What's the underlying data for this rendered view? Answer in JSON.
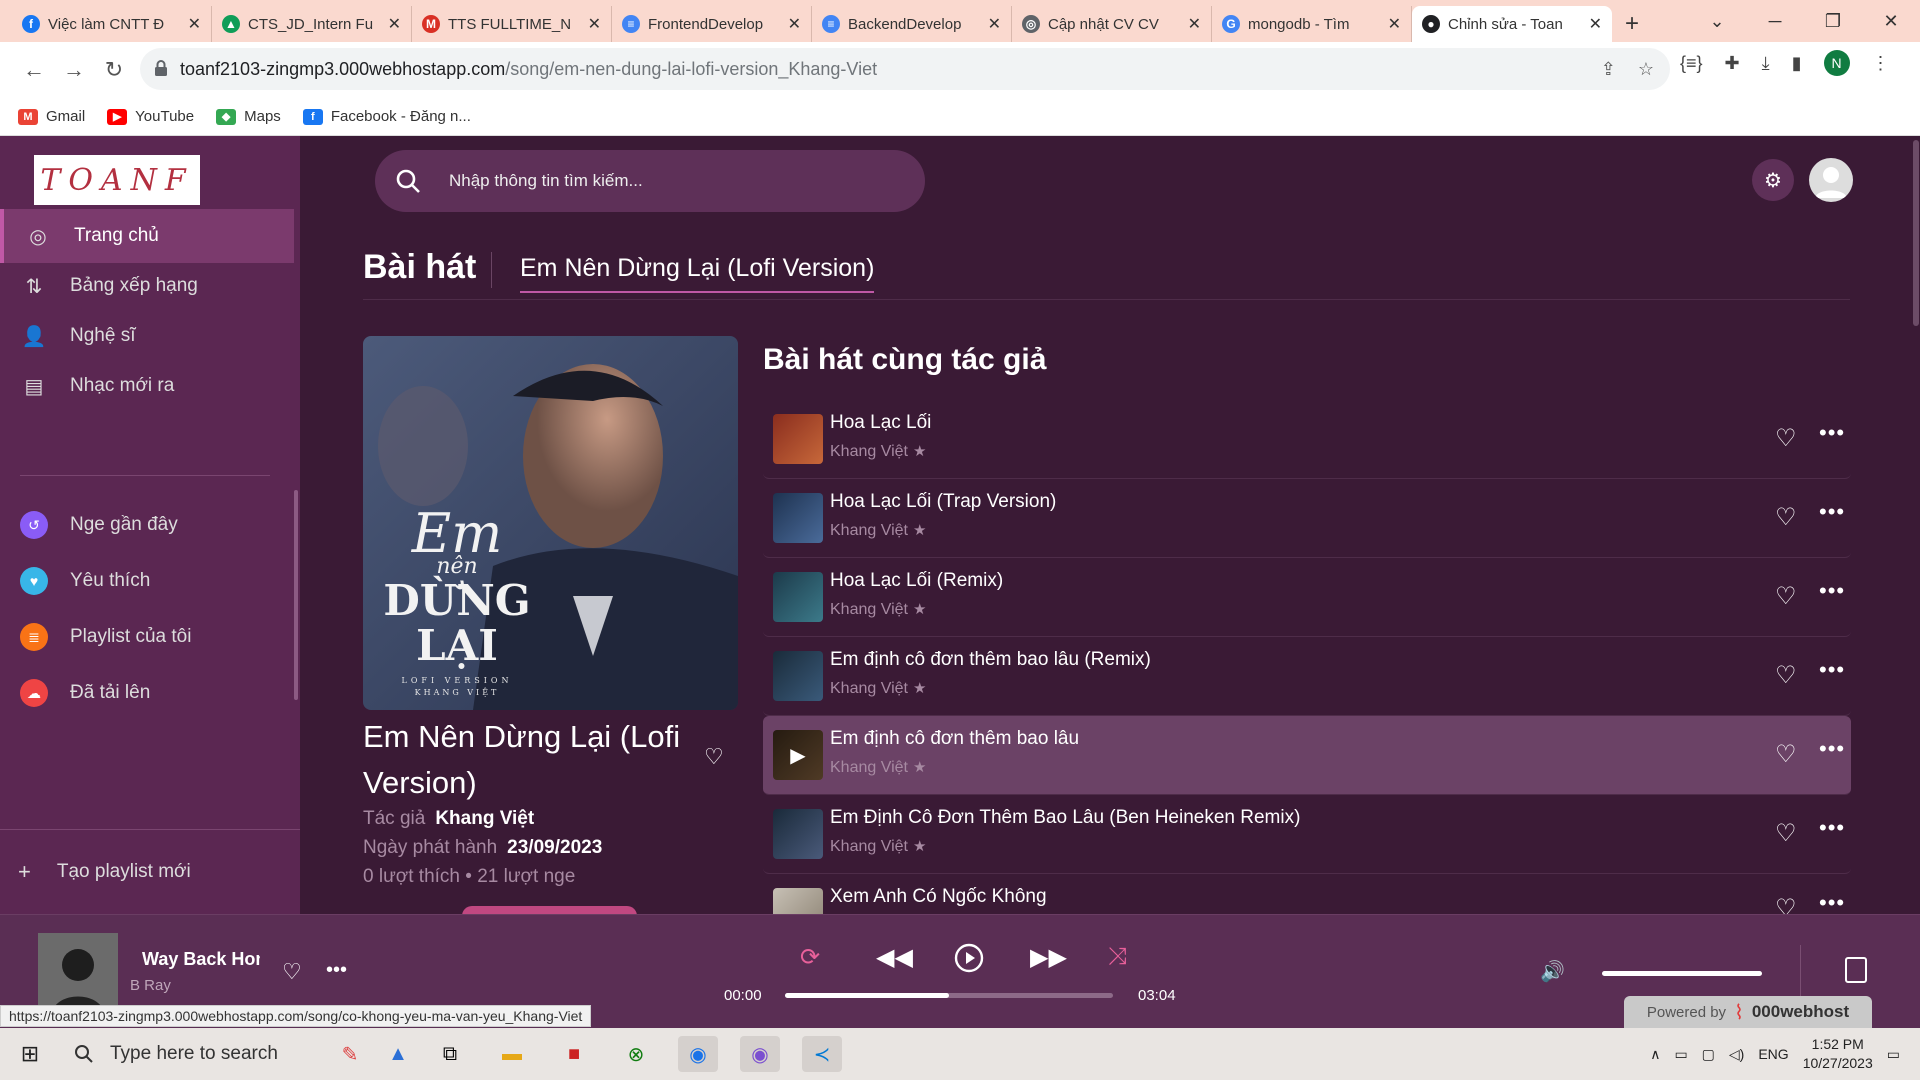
{
  "browser": {
    "tabs": [
      {
        "title": "Việc làm CNTT Đ",
        "color": "#1877f2",
        "glyph": "f"
      },
      {
        "title": "CTS_JD_Intern Fu",
        "color": "#0f9d58",
        "glyph": "▲"
      },
      {
        "title": "TTS FULLTIME_N",
        "color": "#d93025",
        "glyph": "M"
      },
      {
        "title": "FrontendDevelop",
        "color": "#4285f4",
        "glyph": "≡"
      },
      {
        "title": "BackendDevelop",
        "color": "#4285f4",
        "glyph": "≡"
      },
      {
        "title": "Cập nhật CV CV",
        "color": "#5f6368",
        "glyph": "◎"
      },
      {
        "title": "mongodb - Tìm",
        "color": "#4285f4",
        "glyph": "G"
      },
      {
        "title": "Chỉnh sửa - Toan",
        "color": "#202124",
        "glyph": "●"
      }
    ],
    "url_domain": "toanf2103-zingmp3.000webhostapp.com",
    "url_path": "/song/em-nen-dung-lai-lofi-version_Khang-Viet",
    "profile_initial": "N",
    "bookmarks": [
      {
        "label": "Gmail",
        "color": "#ea4335",
        "glyph": "M"
      },
      {
        "label": "YouTube",
        "color": "#ff0000",
        "glyph": "▶"
      },
      {
        "label": "Maps",
        "color": "#34a853",
        "glyph": "◆"
      },
      {
        "label": "Facebook - Đăng n...",
        "color": "#1877f2",
        "glyph": "f"
      }
    ]
  },
  "sidebar": {
    "logo": "TOANF",
    "items": [
      {
        "label": "Trang chủ",
        "icon": "home-disc-icon"
      },
      {
        "label": "Bảng xếp hạng",
        "icon": "ranking-icon"
      },
      {
        "label": "Nghệ sĩ",
        "icon": "artist-icon"
      },
      {
        "label": "Nhạc mới ra",
        "icon": "news-icon"
      }
    ],
    "library": [
      {
        "label": "Nge gần đây",
        "color": "#8a5cf6",
        "glyph": "↺"
      },
      {
        "label": "Yêu thích",
        "color": "#38b6e8",
        "glyph": "♥"
      },
      {
        "label": "Playlist của tôi",
        "color": "#f97316",
        "glyph": "≣"
      },
      {
        "label": "Đã tải lên",
        "color": "#ef4444",
        "glyph": "☁"
      }
    ],
    "new_playlist": "Tạo playlist mới"
  },
  "search": {
    "placeholder": "Nhập thông tin tìm kiếm..."
  },
  "header": {
    "title": "Bài hát",
    "active_tab": "Em Nên Dừng Lại (Lofi Version)"
  },
  "song": {
    "cover_text_1": "Em",
    "cover_text_2": "nên",
    "cover_text_3": "DỪNG",
    "cover_text_4": "LẠI",
    "cover_sub": "LOFI VERSION",
    "cover_artist": "KHANG VIỆT",
    "title": "Em Nên Dừng Lại (Lofi Version)",
    "author_label": "Tác giả",
    "author": "Khang Việt",
    "release_label": "Ngày phát hành",
    "release_date": "23/09/2023",
    "stats": "0 lượt thích • 21 lượt nge"
  },
  "related": {
    "title": "Bài hát cùng tác giả",
    "songs": [
      {
        "name": "Hoa Lạc Lối",
        "artist": "Khang Việt"
      },
      {
        "name": "Hoa Lạc Lối (Trap Version)",
        "artist": "Khang Việt"
      },
      {
        "name": "Hoa Lạc Lối (Remix)",
        "artist": "Khang Việt"
      },
      {
        "name": "Em định cô đơn thêm bao lâu (Remix)",
        "artist": "Khang Việt"
      },
      {
        "name": "Em định cô đơn thêm bao lâu",
        "artist": "Khang Việt"
      },
      {
        "name": "Em Định Cô Đơn Thêm Bao Lâu (Ben Heineken Remix)",
        "artist": "Khang Việt"
      },
      {
        "name": "Xem Anh Có Ngốc Không",
        "artist": ""
      }
    ]
  },
  "player": {
    "title": "Way Back Home",
    "artist": "B Ray",
    "time_current": "00:00",
    "time_total": "03:04",
    "progress": 0.5,
    "volume": 1.0
  },
  "status_url": "https://toanf2103-zingmp3.000webhostapp.com/song/co-khong-yeu-ma-van-yeu_Khang-Viet",
  "powered": {
    "label": "Powered by",
    "brand": "000webhost"
  },
  "taskbar": {
    "search_placeholder": "Type here to search",
    "lang": "ENG",
    "time": "1:52 PM",
    "date": "10/27/2023"
  }
}
